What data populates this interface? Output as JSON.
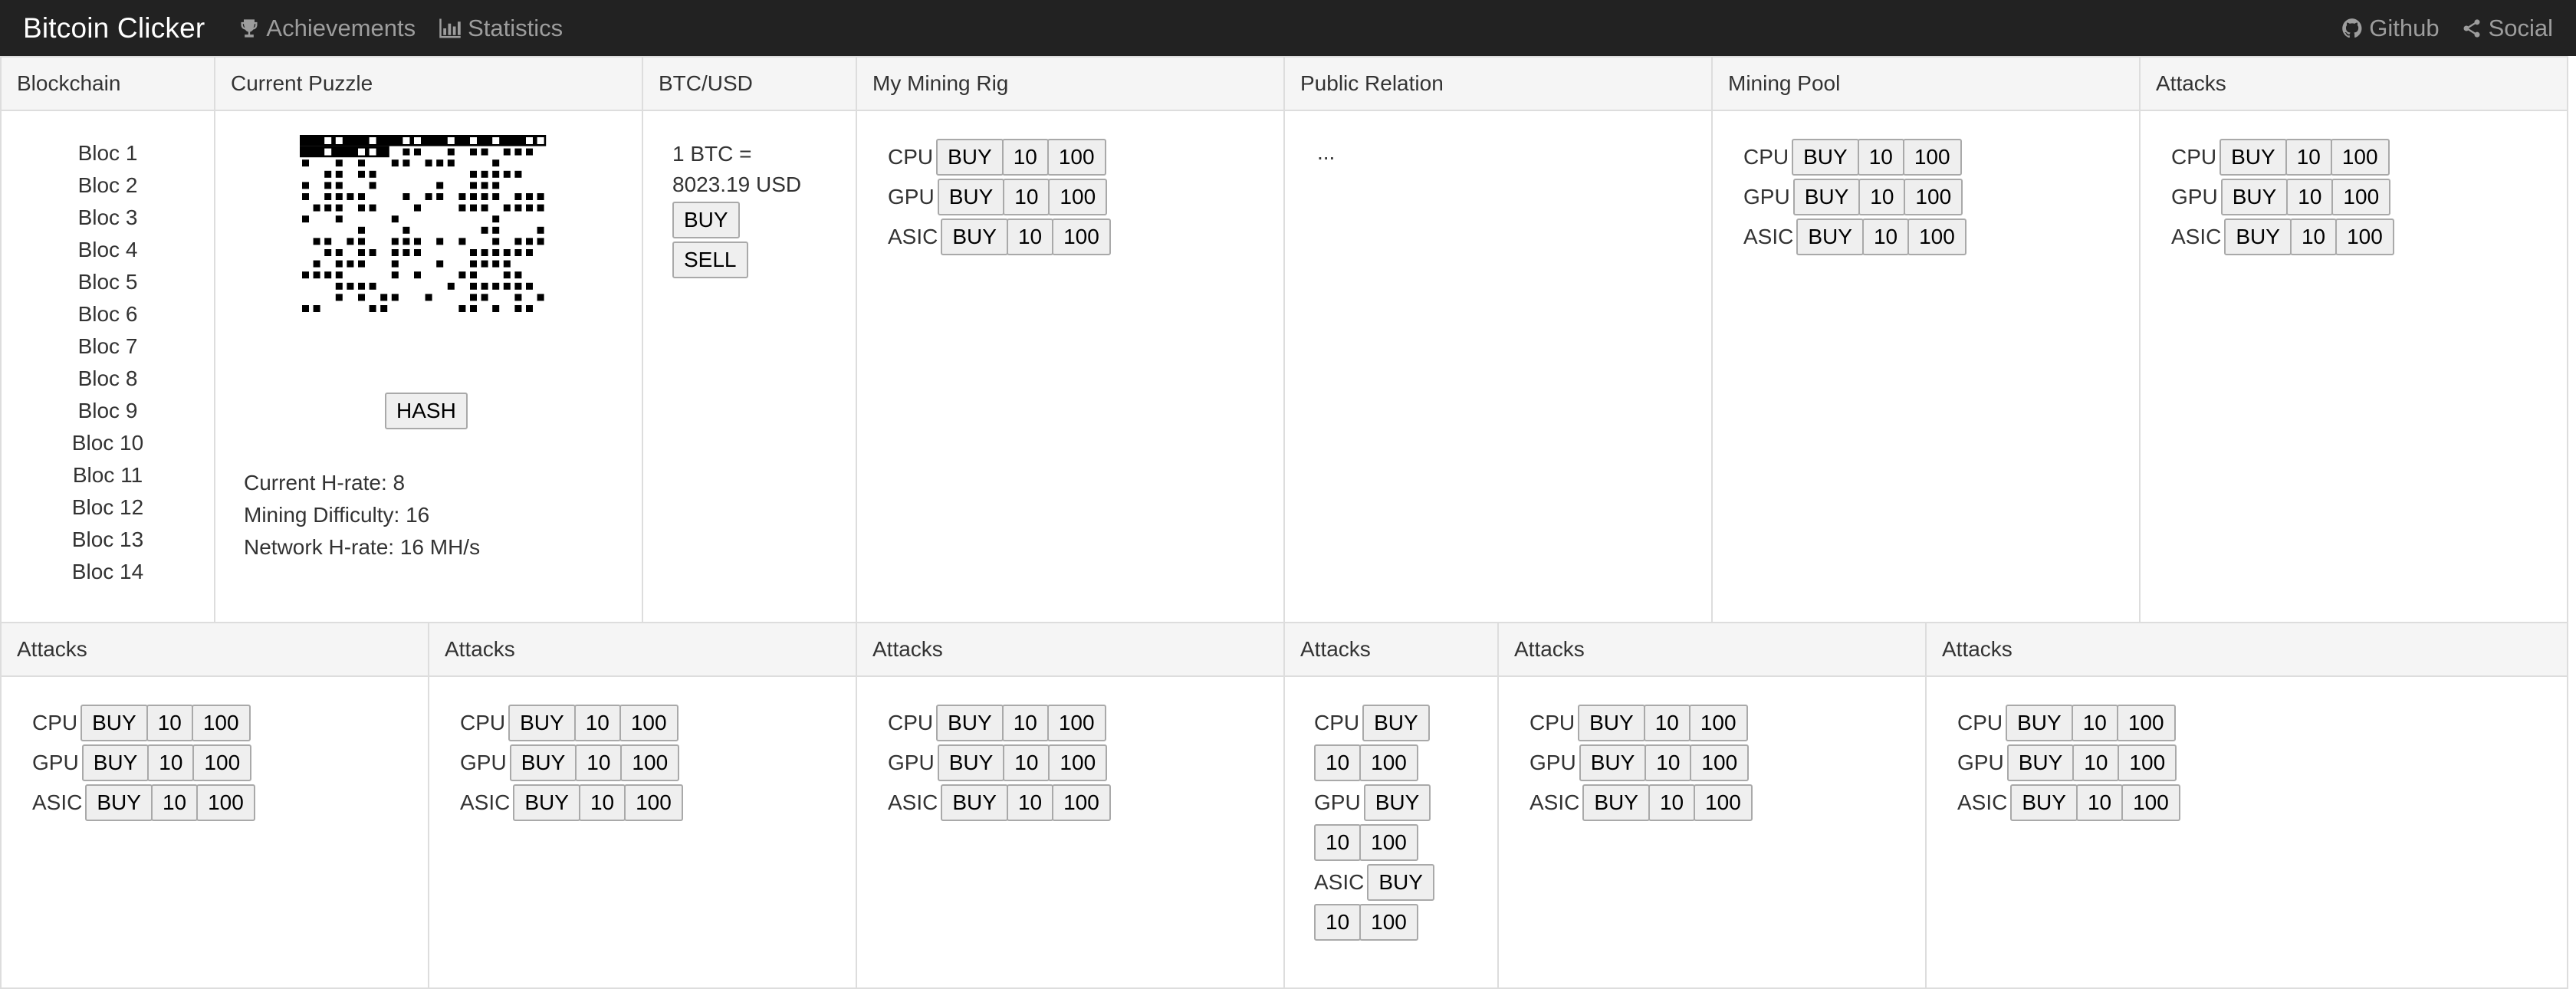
{
  "navbar": {
    "brand": "Bitcoin Clicker",
    "achievements_label": "Achievements",
    "achievements_icon": "trophy-icon",
    "statistics_label": "Statistics",
    "statistics_icon": "bar-chart-icon",
    "github_label": "Github",
    "github_icon": "github-icon",
    "social_label": "Social",
    "social_icon": "share-icon"
  },
  "blockchain": {
    "title": "Blockchain",
    "blocs": [
      "Bloc 1",
      "Bloc 2",
      "Bloc 3",
      "Bloc 4",
      "Bloc 5",
      "Bloc 6",
      "Bloc 7",
      "Bloc 8",
      "Bloc 9",
      "Bloc 10",
      "Bloc 11",
      "Bloc 12",
      "Bloc 13",
      "Bloc 14"
    ]
  },
  "puzzle": {
    "title": "Current Puzzle",
    "hash_label": "HASH",
    "current_hrate": "Current H-rate: 8",
    "difficulty": "Mining Difficulty: 16",
    "network_hrate": "Network H-rate: 16 MH/s"
  },
  "btcusd": {
    "title": "BTC/USD",
    "rate_line1": "1 BTC =",
    "rate_line2": "8023.19 USD",
    "buy_label": "BUY",
    "sell_label": "SELL"
  },
  "mining_rig": {
    "title": "My Mining Rig",
    "rows": [
      {
        "label": "CPU",
        "buy": "BUY",
        "ten": "10",
        "hundred": "100"
      },
      {
        "label": "GPU",
        "buy": "BUY",
        "ten": "10",
        "hundred": "100"
      },
      {
        "label": "ASIC",
        "buy": "BUY",
        "ten": "10",
        "hundred": "100"
      }
    ]
  },
  "public_relation": {
    "title": "Public Relation",
    "text": "..."
  },
  "mining_pool": {
    "title": "Mining Pool",
    "rows": [
      {
        "label": "CPU",
        "buy": "BUY",
        "ten": "10",
        "hundred": "100"
      },
      {
        "label": "GPU",
        "buy": "BUY",
        "ten": "10",
        "hundred": "100"
      },
      {
        "label": "ASIC",
        "buy": "BUY",
        "ten": "10",
        "hundred": "100"
      }
    ]
  },
  "attacks_top": {
    "title": "Attacks",
    "rows": [
      {
        "label": "CPU",
        "buy": "BUY",
        "ten": "10",
        "hundred": "100"
      },
      {
        "label": "GPU",
        "buy": "BUY",
        "ten": "10",
        "hundred": "100"
      },
      {
        "label": "ASIC",
        "buy": "BUY",
        "ten": "10",
        "hundred": "100"
      }
    ]
  },
  "attacks_bottom": [
    {
      "title": "Attacks",
      "rows": [
        {
          "label": "CPU",
          "buy": "BUY",
          "ten": "10",
          "hundred": "100"
        },
        {
          "label": "GPU",
          "buy": "BUY",
          "ten": "10",
          "hundred": "100"
        },
        {
          "label": "ASIC",
          "buy": "BUY",
          "ten": "10",
          "hundred": "100"
        }
      ]
    },
    {
      "title": "Attacks",
      "rows": [
        {
          "label": "CPU",
          "buy": "BUY",
          "ten": "10",
          "hundred": "100"
        },
        {
          "label": "GPU",
          "buy": "BUY",
          "ten": "10",
          "hundred": "100"
        },
        {
          "label": "ASIC",
          "buy": "BUY",
          "ten": "10",
          "hundred": "100"
        }
      ]
    },
    {
      "title": "Attacks",
      "rows": [
        {
          "label": "CPU",
          "buy": "BUY",
          "ten": "10",
          "hundred": "100"
        },
        {
          "label": "GPU",
          "buy": "BUY",
          "ten": "10",
          "hundred": "100"
        },
        {
          "label": "ASIC",
          "buy": "BUY",
          "ten": "10",
          "hundred": "100"
        }
      ]
    },
    {
      "title": "Attacks",
      "rows": [
        {
          "label": "CPU",
          "buy": "BUY",
          "ten": "10",
          "hundred": "100"
        },
        {
          "label": "GPU",
          "buy": "BUY",
          "ten": "10",
          "hundred": "100"
        },
        {
          "label": "ASIC",
          "buy": "BUY",
          "ten": "10",
          "hundred": "100"
        }
      ]
    },
    {
      "title": "Attacks",
      "rows": [
        {
          "label": "CPU",
          "buy": "BUY",
          "ten": "10",
          "hundred": "100"
        },
        {
          "label": "GPU",
          "buy": "BUY",
          "ten": "10",
          "hundred": "100"
        },
        {
          "label": "ASIC",
          "buy": "BUY",
          "ten": "10",
          "hundred": "100"
        }
      ]
    },
    {
      "title": "Attacks",
      "rows": [
        {
          "label": "CPU",
          "buy": "BUY",
          "ten": "10",
          "hundred": "100"
        },
        {
          "label": "GPU",
          "buy": "BUY",
          "ten": "10",
          "hundred": "100"
        },
        {
          "label": "ASIC",
          "buy": "BUY",
          "ten": "10",
          "hundred": "100"
        }
      ]
    }
  ],
  "colors": {
    "navbar_bg": "#222222",
    "brand": "#ffffff",
    "nav_link": "#9d9d9d",
    "panel_heading_bg": "#f5f5f5",
    "border": "#dddddd"
  }
}
